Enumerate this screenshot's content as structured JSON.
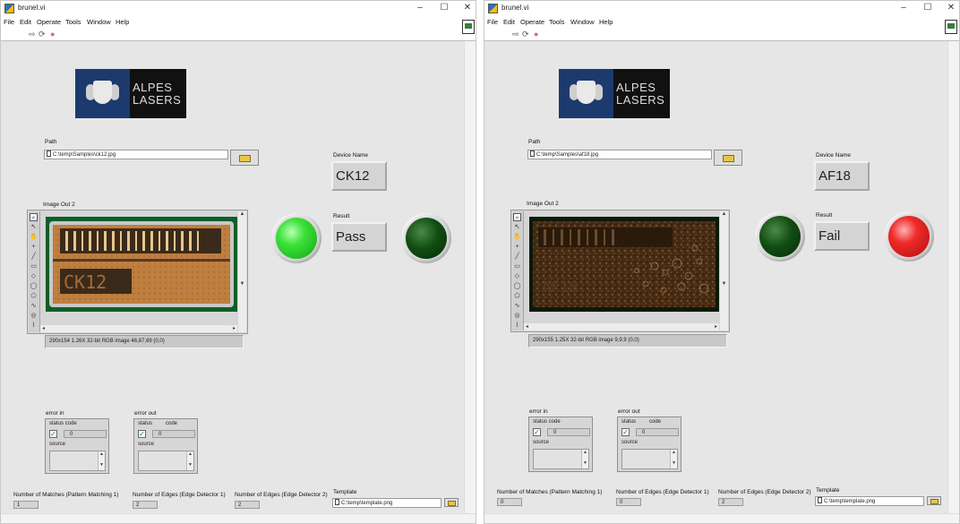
{
  "windows": [
    {
      "title": "brunel.vi",
      "menu": [
        "File",
        "Edit",
        "Operate",
        "Tools",
        "Window",
        "Help"
      ],
      "logo": {
        "line1": "ALPES",
        "line2": "LASERS"
      },
      "path_label": "Path",
      "path_value": "C:\\temp\\Samples\\ck12.jpg",
      "device_name_label": "Device Name",
      "device_name": "CK12",
      "result_label": "Result",
      "result": "Pass",
      "image_label": "Image Out 2",
      "image_info": "290x154 1.26X 32-bit RGB image 46,87,69    (0,0)",
      "error_in": {
        "label": "error in",
        "status_label": "status code",
        "code": "0",
        "source_label": "source"
      },
      "error_out": {
        "label": "error out",
        "status_label": "status",
        "code_label": "code",
        "code": "0",
        "source_label": "source"
      },
      "matches_label": "Number of Matches (Pattern Matching 1)",
      "matches": "1",
      "edges1_label": "Number of Edges (Edge Detector 1)",
      "edges1": "2",
      "edges2_label": "Number of Edges (Edge Detector 2)",
      "edges2": "2",
      "template_label": "Template",
      "template_value": "C:\\temp\\template.png",
      "sample_text": "CK12",
      "leds": {
        "pass": "on",
        "fail": "off"
      }
    },
    {
      "title": "brunel.vi",
      "menu": [
        "File",
        "Edit",
        "Operate",
        "Tools",
        "Window",
        "Help"
      ],
      "logo": {
        "line1": "ALPES",
        "line2": "LASERS"
      },
      "path_label": "Path",
      "path_value": "C:\\temp\\Samples\\af18.jpg",
      "device_name_label": "Device Name",
      "device_name": "AF18",
      "result_label": "Result",
      "result": "Fail",
      "image_label": "Image Out 2",
      "image_info": "290x155 1.25X 32-bit RGB image 9,9,9    (0,0)",
      "error_in": {
        "label": "error in",
        "status_label": "status code",
        "code": "0",
        "source_label": "source"
      },
      "error_out": {
        "label": "error out",
        "status_label": "status",
        "code_label": "code",
        "code": "0",
        "source_label": "source"
      },
      "matches_label": "Number of Matches (Pattern Matching 1)",
      "matches": "0",
      "edges1_label": "Number of Edges (Edge Detector 1)",
      "edges1": "0",
      "edges2_label": "Number of Edges (Edge Detector 2)",
      "edges2": "2",
      "template_label": "Template",
      "template_value": "C:\\temp\\template.png",
      "sample_text": "AF18",
      "leds": {
        "pass": "off",
        "fail": "on"
      }
    }
  ],
  "colors": {
    "led_green_on": "#3de13a",
    "led_green_off": "#114d12",
    "led_red_on": "#ef2a2a",
    "logo_blue": "#1c3a6e"
  }
}
